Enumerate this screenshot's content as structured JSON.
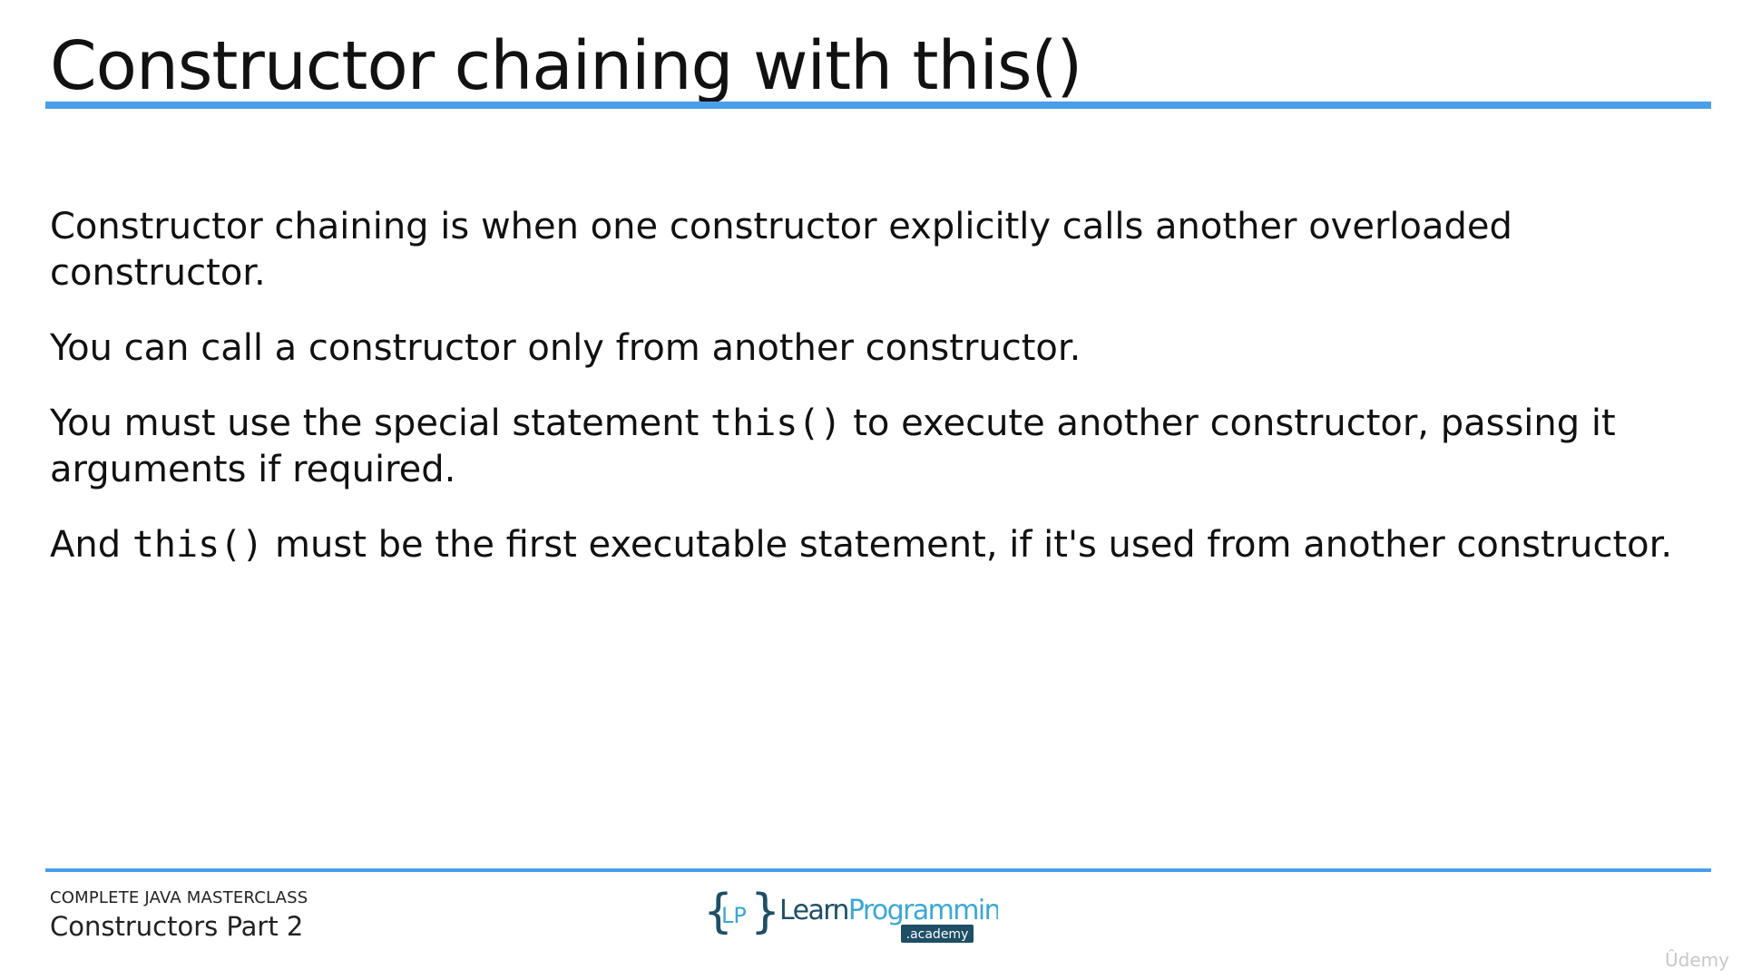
{
  "slide": {
    "title": "Constructor chaining with this()",
    "paragraphs": [
      {
        "text": "Constructor chaining is when one constructor explicitly calls another overloaded constructor."
      },
      {
        "text": "You can call a constructor only from another constructor."
      },
      {
        "before": "You must use the special statement ",
        "code": "this()",
        "after": " to execute another constructor, passing it arguments if required."
      },
      {
        "before": "And ",
        "code": "this()",
        "after": " must be the first executable statement, if it's used from another constructor."
      }
    ]
  },
  "footer": {
    "course": "COMPLETE JAVA MASTERCLASS",
    "lecture": "Constructors Part 2",
    "logo": {
      "brace_open": "{",
      "initials": "LP",
      "brace_close": "}",
      "word1": "Learn",
      "word2": "Programming",
      "sub": ".academy"
    }
  },
  "watermark": "Ûdemy",
  "colors": {
    "accent": "#4a9eea",
    "logo_dark": "#1e4f66",
    "logo_light": "#3aa7d6"
  }
}
